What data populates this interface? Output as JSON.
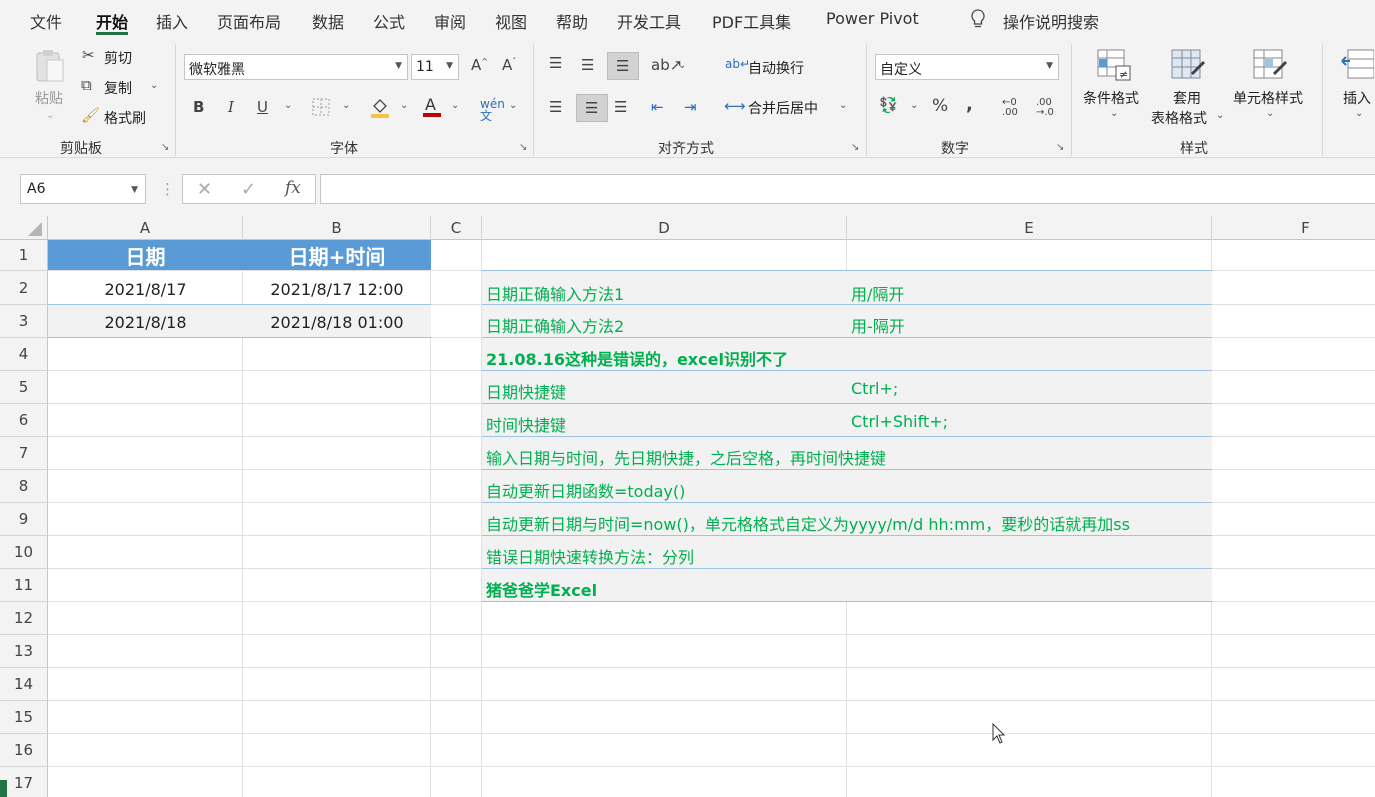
{
  "menu": {
    "tabs": [
      "文件",
      "开始",
      "插入",
      "页面布局",
      "数据",
      "公式",
      "审阅",
      "视图",
      "帮助",
      "开发工具",
      "PDF工具集",
      "Power Pivot"
    ],
    "active_tab": "开始",
    "search_label": "操作说明搜索"
  },
  "ribbon": {
    "clipboard": {
      "paste": "粘贴",
      "cut": "剪切",
      "copy": "复制",
      "format_painter": "格式刷",
      "group": "剪贴板"
    },
    "font": {
      "name": "微软雅黑",
      "size": "11",
      "bold": "B",
      "italic": "I",
      "underline": "U",
      "group": "字体"
    },
    "alignment": {
      "wrap": "自动换行",
      "merge": "合并后居中",
      "group": "对齐方式"
    },
    "number": {
      "format": "自定义",
      "percent": "%",
      "comma": ",",
      "group": "数字"
    },
    "styles": {
      "conditional": "条件格式",
      "table_line1": "套用",
      "table_line2": "表格格式",
      "cell_styles": "单元格样式",
      "group": "样式"
    },
    "cells": {
      "insert": "插入"
    }
  },
  "formula_bar": {
    "name_box": "A6",
    "fx": "fx",
    "formula": ""
  },
  "columns": [
    "A",
    "B",
    "C",
    "D",
    "E",
    "F"
  ],
  "rows": [
    "1",
    "2",
    "3",
    "4",
    "5",
    "6",
    "7",
    "8",
    "9",
    "10",
    "11",
    "12",
    "13",
    "14",
    "15",
    "16",
    "17"
  ],
  "sheet": {
    "A1": "日期",
    "B1": "日期+时间",
    "A2": "2021/8/17",
    "B2": "2021/8/17 12:00",
    "A3": "2021/8/18",
    "B3": "2021/8/18 01:00",
    "D2": "日期正确输入方法1",
    "E2": "用/隔开",
    "D3": "日期正确输入方法2",
    "E3": "用-隔开",
    "D4": "21.08.16这种是错误的，excel识别不了",
    "D5": "日期快捷键",
    "E5": "Ctrl+;",
    "D6": "时间快捷键",
    "E6": "Ctrl+Shift+;",
    "D7": "输入日期与时间，先日期快捷，之后空格，再时间快捷键",
    "D8": "自动更新日期函数=today()",
    "D9": "自动更新日期与时间=now()，单元格格式自定义为yyyy/m/d hh:mm，要秒的话就再加ss",
    "D10": "错误日期快速转换方法：分列",
    "D11": "猪爸爸学Excel"
  }
}
